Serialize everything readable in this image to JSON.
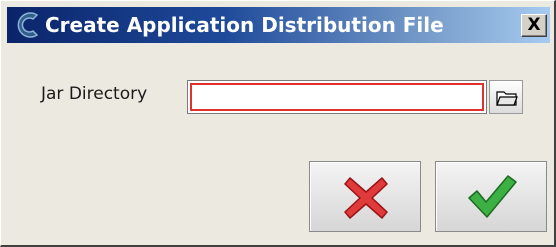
{
  "window": {
    "title": "Create Application Distribution File",
    "close_label": "X"
  },
  "form": {
    "jar_directory_label": "Jar Directory",
    "jar_directory_value": "",
    "jar_directory_placeholder": ""
  },
  "icons": {
    "app_logo": "c-logo-icon",
    "browse": "folder-icon",
    "cancel": "red-x-icon",
    "ok": "green-checkmark-icon"
  },
  "colors": {
    "titlebar_start": "#0a246a",
    "titlebar_end": "#a6caf0",
    "input_error_border": "#e03030",
    "cancel_icon": "#e03a3a",
    "ok_icon": "#3cb043",
    "window_background": "#ece9e1"
  }
}
